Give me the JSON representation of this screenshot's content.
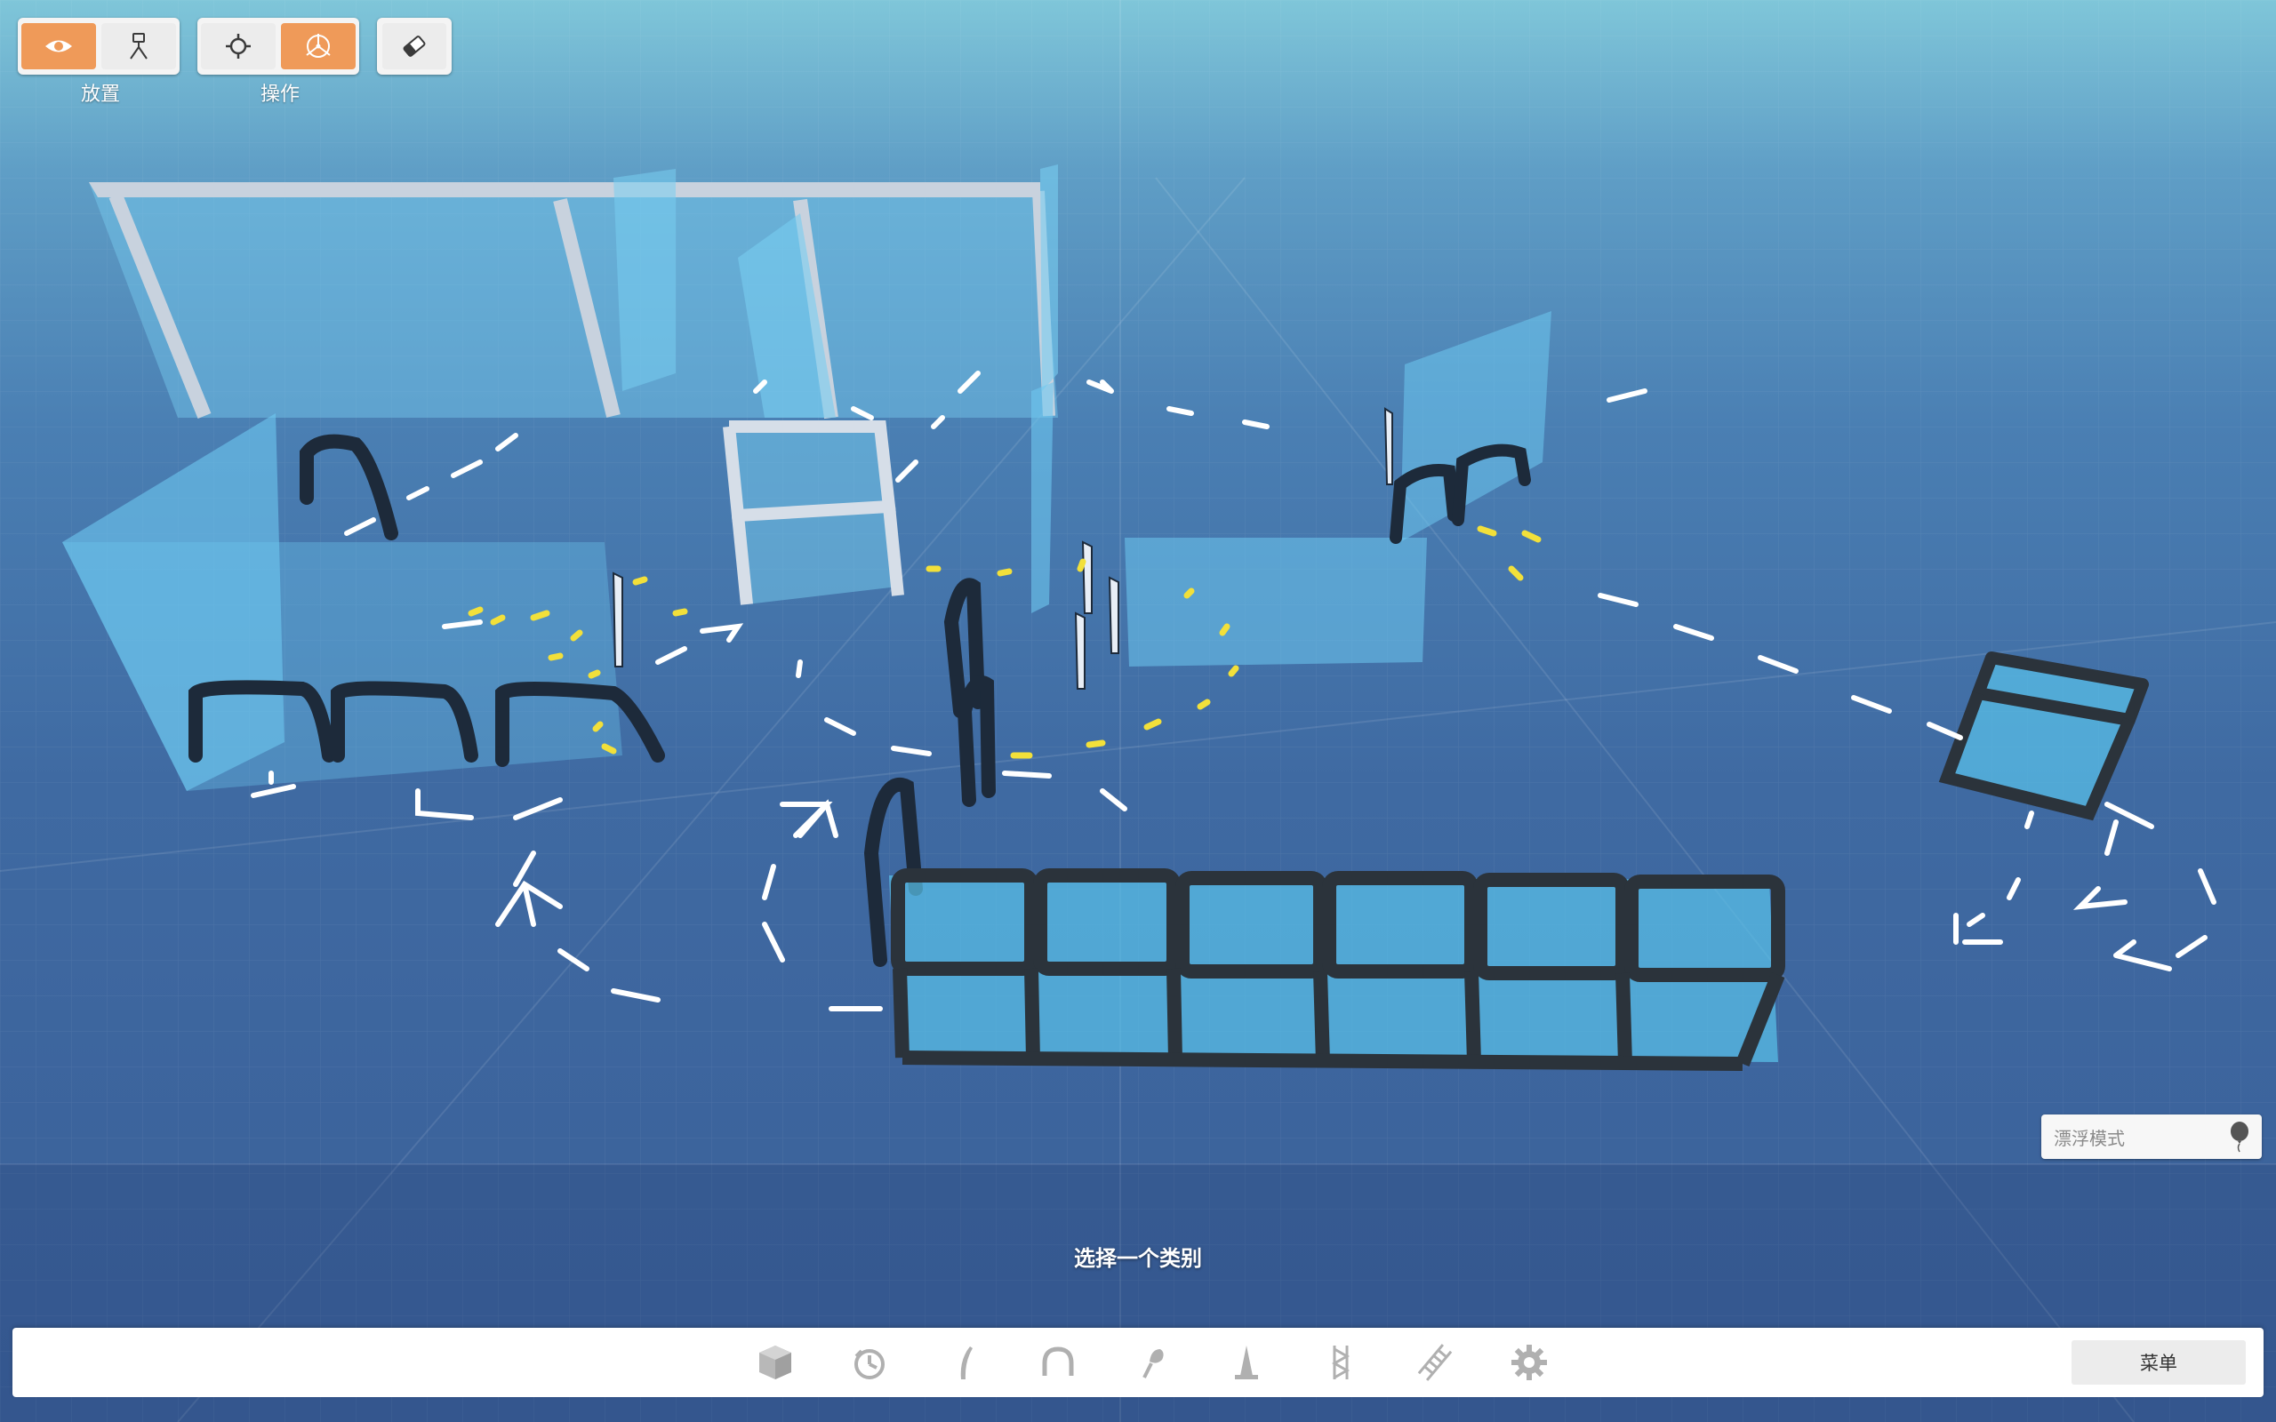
{
  "toolbar": {
    "placement": {
      "label": "放置",
      "buttons": [
        {
          "icon": "eye-icon",
          "active": true
        },
        {
          "icon": "camera-tripod-icon",
          "active": false
        }
      ]
    },
    "operation": {
      "label": "操作",
      "buttons": [
        {
          "icon": "crosshair-icon",
          "active": false
        },
        {
          "icon": "transform-gizmo-icon",
          "active": true
        }
      ]
    },
    "eraser": {
      "icon": "eraser-icon",
      "active": false
    }
  },
  "hover_mode": {
    "placeholder": "漂浮模式",
    "icon": "balloon-icon"
  },
  "prompt": "选择一个类别",
  "bottom_bar": {
    "categories": [
      {
        "icon": "cube-icon"
      },
      {
        "icon": "timer-icon"
      },
      {
        "icon": "pole-icon"
      },
      {
        "icon": "arch-icon"
      },
      {
        "icon": "flag-icon"
      },
      {
        "icon": "cone-icon"
      },
      {
        "icon": "truss-icon"
      },
      {
        "icon": "ladder-icon"
      },
      {
        "icon": "gear-icon"
      }
    ],
    "menu_label": "菜单"
  },
  "colors": {
    "accent_active": "#ef9a59",
    "panel": "#f4f4f4",
    "glass": "#5fc3e8",
    "arrow_white": "#ffffff",
    "arrow_yellow": "#f2e03a"
  }
}
